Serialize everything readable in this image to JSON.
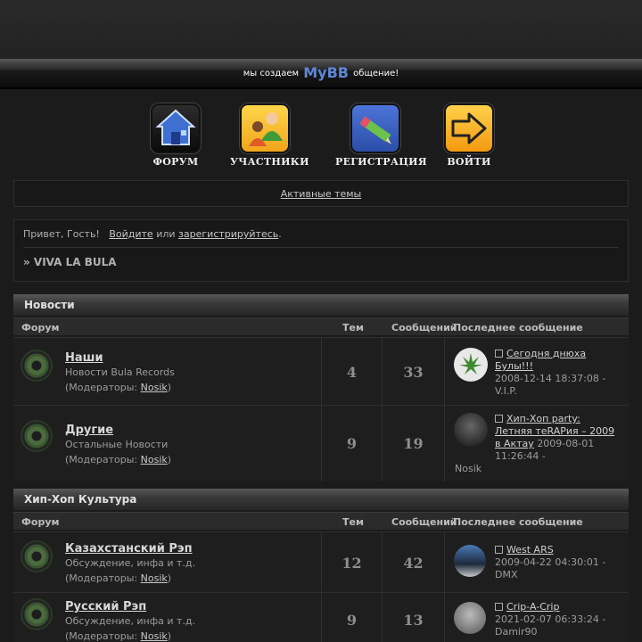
{
  "banner": {
    "prefix": "мы создаем",
    "logo": "MyBB",
    "suffix": "общение!"
  },
  "nav": [
    {
      "label": "ФОРУМ",
      "icon": "home-icon"
    },
    {
      "label": "УЧАСТНИКИ",
      "icon": "users-icon"
    },
    {
      "label": "РЕГИСТРАЦИЯ",
      "icon": "pencil-icon"
    },
    {
      "label": "ВОЙТИ",
      "icon": "login-arrow-icon"
    }
  ],
  "active_topics": "Активные темы",
  "welcome": {
    "greeting": "Привет, Гость!",
    "login": "Войдите",
    "or": "или",
    "register": "зарегистрируйтесь",
    "dot": ".",
    "breadcrumb": "» VIVA LA BULA"
  },
  "columns": {
    "forum": "Форум",
    "topics": "Тем",
    "posts": "Сообщений",
    "last": "Последнее сообщение"
  },
  "moderators_prefix": "(Модераторы:",
  "moderators_suffix": ")",
  "categories": [
    {
      "title": "Новости",
      "forums": [
        {
          "name": "Наши",
          "desc": "Новости Bula Records",
          "moderator": "Nosik",
          "topics": "4",
          "posts": "33",
          "last_title_1": "Сегодня днюха",
          "last_title_2": "Булы!!!",
          "last_date": "2008-12-14 18:37:08 -",
          "last_user": "V.I.P."
        },
        {
          "name": "Другие",
          "desc": "Остальные Новости",
          "moderator": "Nosik",
          "topics": "9",
          "posts": "19",
          "last_title_1": "Хип-Хоп party:",
          "last_title_2": "Летняя теRAPия – 2009",
          "last_title_3": "в Актау",
          "last_date": "2009-08-01 11:26:44 -",
          "last_user": "Nosik"
        }
      ]
    },
    {
      "title": "Хип-Хоп Культура",
      "forums": [
        {
          "name": "Казахстанский Рэп",
          "desc": "Обсуждение, инфа и т.д.",
          "moderator": "Nosik",
          "topics": "12",
          "posts": "42",
          "last_title_1": "West ARS",
          "last_date": "2009-04-22 04:30:01 -",
          "last_user": "DMX"
        },
        {
          "name": "Русский Рэп",
          "desc": "Обсуждение, инфа и т.д.",
          "moderator": "Nosik",
          "topics": "9",
          "posts": "13",
          "last_title_1": "Crip-A-Crip",
          "last_date": "2021-02-07 06:33:24 -",
          "last_user": "Damir90"
        }
      ]
    }
  ]
}
